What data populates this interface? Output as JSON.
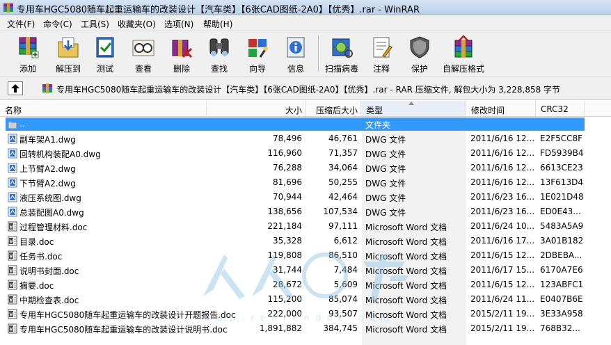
{
  "window": {
    "title": "专用车HGC5080随车起重运输车的改装设计【汽车类】【6张CAD图纸-2A0】【优秀】.rar - WinRAR"
  },
  "menu": [
    "文件(F)",
    "命令(C)",
    "工具(S)",
    "收藏夹(O)",
    "选项(N)",
    "帮助(H)"
  ],
  "toolbar": [
    {
      "label": "添加",
      "icon": "add-archive-icon"
    },
    {
      "label": "解压到",
      "icon": "extract-to-icon"
    },
    {
      "label": "测试",
      "icon": "test-icon"
    },
    {
      "label": "查看",
      "icon": "view-icon"
    },
    {
      "label": "删除",
      "icon": "delete-icon"
    },
    {
      "label": "查找",
      "icon": "find-icon"
    },
    {
      "label": "向导",
      "icon": "wizard-icon"
    },
    {
      "label": "信息",
      "icon": "info-icon"
    },
    {
      "label": "扫描病毒",
      "icon": "virus-scan-icon"
    },
    {
      "label": "注释",
      "icon": "comment-icon"
    },
    {
      "label": "保护",
      "icon": "protect-icon"
    },
    {
      "label": "自解压格式",
      "icon": "sfx-icon"
    }
  ],
  "path_bar": {
    "text": "专用车HGC5080随车起重运输车的改装设计【汽车类】【6张CAD图纸-2A0】【优秀】.rar - RAR 压缩文件, 解包大小为 3,228,858 字节"
  },
  "columns": {
    "name": "名称",
    "size": "大小",
    "packed": "压缩后大小",
    "type": "类型",
    "modified": "修改时间",
    "crc": "CRC32"
  },
  "files": [
    {
      "name": "..",
      "size": "",
      "packed": "",
      "type": "文件夹",
      "modified": "",
      "crc": "",
      "kind": "folder-up",
      "selected": true
    },
    {
      "name": "副车架A1.dwg",
      "size": "78,496",
      "packed": "46,761",
      "type": "DWG 文件",
      "modified": "2011/6/16 12...",
      "crc": "E2F5CC8F",
      "kind": "dwg"
    },
    {
      "name": "回转机构装配A0.dwg",
      "size": "116,960",
      "packed": "71,357",
      "type": "DWG 文件",
      "modified": "2011/6/16 12...",
      "crc": "FD5939B4",
      "kind": "dwg"
    },
    {
      "name": "上节臂A2.dwg",
      "size": "76,288",
      "packed": "34,064",
      "type": "DWG 文件",
      "modified": "2011/6/16 12...",
      "crc": "6613CE23",
      "kind": "dwg"
    },
    {
      "name": "下节臂A2.dwg",
      "size": "81,696",
      "packed": "50,255",
      "type": "DWG 文件",
      "modified": "2011/6/16 12...",
      "crc": "13F613D4",
      "kind": "dwg"
    },
    {
      "name": "液压系统图.dwg",
      "size": "70,944",
      "packed": "42,464",
      "type": "DWG 文件",
      "modified": "2011/6/23 16...",
      "crc": "1E021D48",
      "kind": "dwg"
    },
    {
      "name": "总装配图A0.dwg",
      "size": "138,656",
      "packed": "107,534",
      "type": "DWG 文件",
      "modified": "2011/6/23 16...",
      "crc": "ED0E43...",
      "kind": "dwg"
    },
    {
      "name": "过程管理材料.doc",
      "size": "221,184",
      "packed": "97,111",
      "type": "Microsoft Word 文档",
      "modified": "2011/6/24 10...",
      "crc": "5483A5A9",
      "kind": "doc"
    },
    {
      "name": "目录.doc",
      "size": "35,328",
      "packed": "6,612",
      "type": "Microsoft Word 文档",
      "modified": "2011/6/16 17...",
      "crc": "3A01B182",
      "kind": "doc"
    },
    {
      "name": "任务书.doc",
      "size": "119,808",
      "packed": "86,510",
      "type": "Microsoft Word 文档",
      "modified": "2011/6/15 12...",
      "crc": "2DBEBA...",
      "kind": "doc"
    },
    {
      "name": "说明书封面.doc",
      "size": "31,744",
      "packed": "7,484",
      "type": "Microsoft Word 文档",
      "modified": "2011/6/17 15...",
      "crc": "6170A7E6",
      "kind": "doc"
    },
    {
      "name": "摘要.doc",
      "size": "28,672",
      "packed": "5,609",
      "type": "Microsoft Word 文档",
      "modified": "2011/6/15 12...",
      "crc": "123ABFC1",
      "kind": "doc"
    },
    {
      "name": "中期检查表.doc",
      "size": "115,200",
      "packed": "85,074",
      "type": "Microsoft Word 文档",
      "modified": "2011/6/24 11...",
      "crc": "E0407B6E",
      "kind": "doc"
    },
    {
      "name": "专用车HGC5080随车起重运输车的改装设计开题报告.doc",
      "size": "222,000",
      "packed": "93,507",
      "type": "Microsoft Word 文档",
      "modified": "2015/2/11 19...",
      "crc": "3E33A958",
      "kind": "doc"
    },
    {
      "name": "专用车HGC5080随车起重运输车的改装设计说明书.doc",
      "size": "1,891,882",
      "packed": "384,745",
      "type": "Microsoft Word 文档",
      "modified": "2015/2/11 19...",
      "crc": "768B32...",
      "kind": "doc"
    }
  ],
  "watermark": {
    "url": "www.renrendoc.com"
  },
  "colors": {
    "selection": "#3399ff",
    "titlebar": "#c8d9ef",
    "toolbar_bg": "#f0f0f0"
  }
}
